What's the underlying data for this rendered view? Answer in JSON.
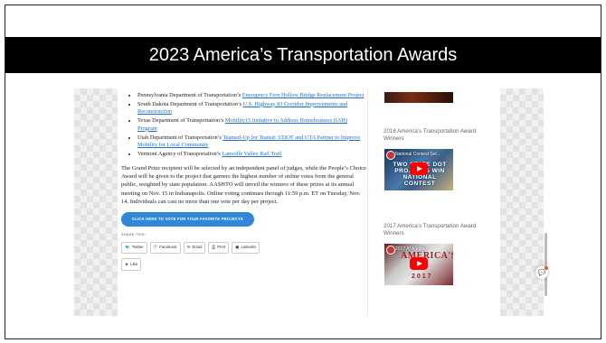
{
  "slide": {
    "title": "2023 America’s Transportation Awards"
  },
  "article": {
    "awards": [
      {
        "prefix": "Pennsylvania Department of Transportation’s ",
        "project": "Emergency Fern Hollow Bridge Replacement Project"
      },
      {
        "prefix": "South Dakota Department of Transportation’s ",
        "project": "U.S. Highway 83 Corridor Improvements and Reconstruction"
      },
      {
        "prefix": "Texas Department of Transportation’s ",
        "project": "Mobility15 Initiative to Address Homelessness (IAH) Program"
      },
      {
        "prefix": "Utah Department of Transportation’s ",
        "project": "Teamed-Up for Transit: UDOT and UTA Partner to Improve Mobility for Local Community"
      },
      {
        "prefix": "Vermont Agency of Transportation’s ",
        "project": "Lamoille Valley Rail Trail"
      }
    ],
    "paragraph": "The Grand Prize recipient will be selected by an independent panel of judges, while the People’s Choice Award will be given to the project that garners the highest number of online votes from the general public, weighted by state population. AASHTO will unveil the winners of these prizes at its annual meeting on Nov. 15 in Indianapolis. Online voting continues through 11:59 p.m. ET on Tuesday, Nov. 14. Individuals can cast no more than one vote per day per project.",
    "vote_button": "CLICK HERE TO VOTE FOR YOUR FAVORITE PROJECTS",
    "share_label": "SHARE THIS:",
    "share_buttons": [
      {
        "icon": "twitter-icon",
        "label": "Twitter"
      },
      {
        "icon": "facebook-icon",
        "label": "Facebook"
      },
      {
        "icon": "email-icon",
        "label": "Email"
      },
      {
        "icon": "print-icon",
        "label": "Print"
      },
      {
        "icon": "linkedin-icon",
        "label": "LinkedIn"
      }
    ],
    "like_button": "Like"
  },
  "sidebar": {
    "caption_2018": "2018 America’s Transportation Award Winners",
    "video_2018": {
      "title": "National Contest Sel...",
      "overlay": "TWO STATE DOT PROJECTS WIN NATIONAL CONTEST"
    },
    "caption_2017": "2017 America’s Transportation Award Winners",
    "video_2017": {
      "title": "2017 ATA Video",
      "overlay_brand": "AMERICA'S",
      "overlay_year": "2017"
    }
  },
  "colors": {
    "title_bar": "#000000",
    "link": "#1e6fd0",
    "vote_button": "#2f87d9",
    "play_button": "#ff0000"
  }
}
